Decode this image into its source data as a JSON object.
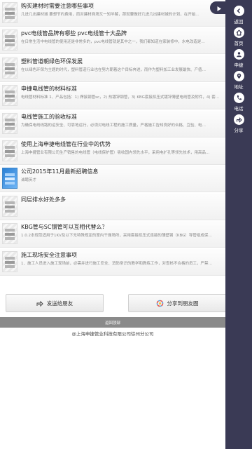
{
  "articles": [
    {
      "title": "购买建材时需要注意哪些事项",
      "desc": "几进几出建材城    要想节约费用，而对建材商场又一知半解，那就要做好几进几出建材城的计划，在开始…",
      "thumb": "gray"
    },
    {
      "title": "pvc电线管品牌有哪些 pvc电线管十大品牌",
      "desc": "在日常生活中电线管的使用还是非常多的，pvc电线管就是其中之一，我们都知道在家装修中，水电改造是…",
      "thumb": "gray"
    },
    {
      "title": "塑料管道朝绿色环保发展",
      "desc": "在以绿色环保为主题的时代，塑料管道行业也在努力朝着这个目标奔进，而作为塑料加工业发展最快、产值…",
      "thumb": "gray"
    },
    {
      "title": "申捷电线管的材料标准",
      "desc": "电线管材料标准 1、产品包括：1) 焊接钢管sc，2) 热镀锌钢管，3) KBG套接扣压式镀锌薄壁电线管及附件，4) 套…",
      "thumb": "gray"
    },
    {
      "title": "电线管施工的验收标准",
      "desc": "为确保电线线路的运安全、可靠地运行，必须对电线工程的施工质量，严格施工告知良好的合格、互验、电…",
      "thumb": "gray"
    },
    {
      "title": "使用上海申捷电线管在行业中的优势",
      "desc": "上海申捷管业有限公司生产销售的电线管（电线保护管）吸收国内领先水平，采用电扩孔等领先技术，用高品…",
      "thumb": "gray"
    },
    {
      "title": "公司2015年11月最新招聘信息",
      "desc": "诚聘英才",
      "thumb": "blue"
    },
    {
      "title": "同层排水好处多多",
      "desc": "",
      "thumb": "gray"
    },
    {
      "title": "KBG管与SC钢管可以互相代替么？",
      "desc": "1.0.2本规范适用于1KV及以下无特殊规定的室内干燥场所，采用套接扣压式连接的薄壁钢（KBG）导管组成保…",
      "thumb": "gray"
    },
    {
      "title": "施工现场安全注意事项",
      "desc": "1、施工人员进入施工现场前，必需并进行施工安全、消防常识的教学和教练工作，对查核不合格的员工，严禁…",
      "thumb": "gray"
    }
  ],
  "share": {
    "friend_label": "发送给朋友",
    "moments_label": "分享到朋友圈"
  },
  "back_to_top": "返回顶部",
  "footer": "@上海申捷管业科技有限公司徐州分公司",
  "sidebar": [
    {
      "label": "返回",
      "icon": "back-icon"
    },
    {
      "label": "首页",
      "icon": "home-icon"
    },
    {
      "label": "申捷",
      "icon": "brand-icon"
    },
    {
      "label": "地址",
      "icon": "location-icon"
    },
    {
      "label": "电话",
      "icon": "phone-icon"
    },
    {
      "label": "分享",
      "icon": "share-icon"
    }
  ],
  "colors": {
    "sidebar_bg": "#3a3a55",
    "back_top_bg": "#8a8a8a",
    "blue_thumb": "#2a7fd4"
  }
}
